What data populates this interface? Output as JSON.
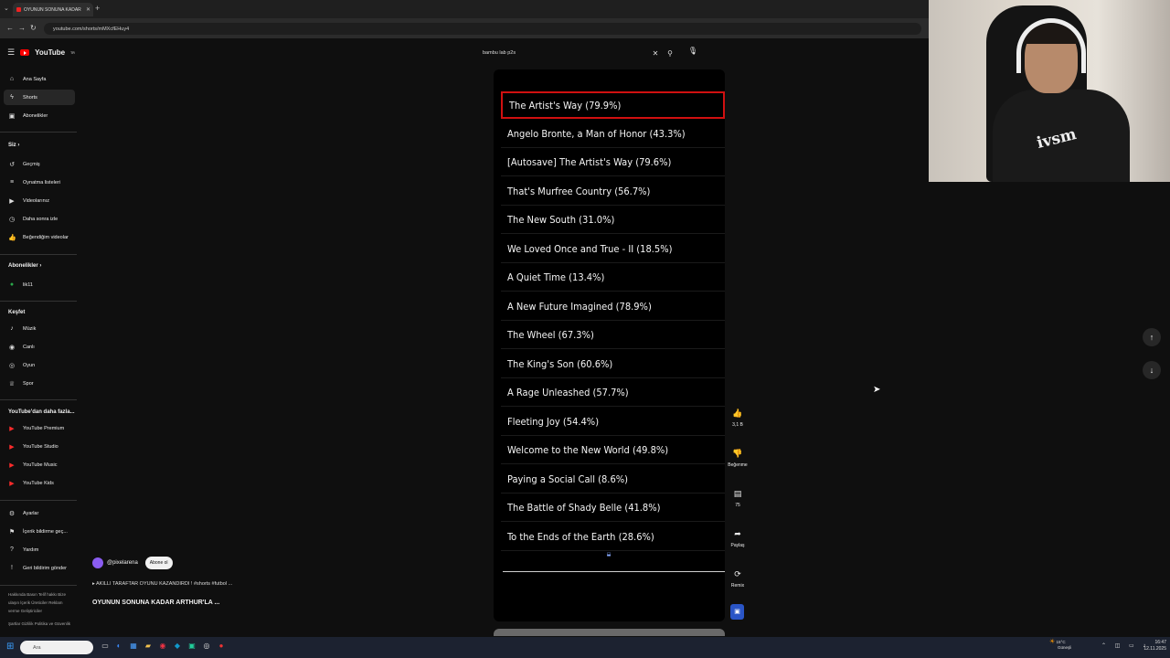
{
  "browser": {
    "tab_title": "OYUNUN SONUNA KADAR",
    "new_tab": "+",
    "url": "youtube.com/shorts/mMXcfEHuy4"
  },
  "youtube": {
    "logo": "YouTube",
    "logo_region": "TR",
    "search_value": "bambu lab p2s",
    "sidebar": {
      "main": [
        {
          "label": "Ana Sayfa",
          "icon": "home-icon"
        },
        {
          "label": "Shorts",
          "icon": "shorts-icon"
        },
        {
          "label": "Abonelikler",
          "icon": "subscriptions-icon"
        }
      ],
      "you_header": "Siz",
      "you": [
        {
          "label": "Geçmiş",
          "icon": "history-icon"
        },
        {
          "label": "Oynatma listeleri",
          "icon": "playlist-icon"
        },
        {
          "label": "Videolarınız",
          "icon": "video-icon"
        },
        {
          "label": "Daha sonra izle",
          "icon": "clock-icon"
        },
        {
          "label": "Beğendiğim videolar",
          "icon": "like-icon"
        }
      ],
      "subs_header": "Abonelikler",
      "subs": [
        {
          "label": "lik11",
          "icon": "channel-avatar-icon"
        }
      ],
      "explore_header": "Keşfet",
      "explore": [
        {
          "label": "Müzik",
          "icon": "music-icon"
        },
        {
          "label": "Canlı",
          "icon": "live-icon"
        },
        {
          "label": "Oyun",
          "icon": "gaming-icon"
        },
        {
          "label": "Spor",
          "icon": "trophy-icon"
        }
      ],
      "more_header": "YouTube'dan daha fazla...",
      "more": [
        {
          "label": "YouTube Premium",
          "icon": "yt-premium-icon"
        },
        {
          "label": "YouTube Studio",
          "icon": "yt-studio-icon"
        },
        {
          "label": "YouTube Music",
          "icon": "yt-music-icon"
        },
        {
          "label": "YouTube Kids",
          "icon": "yt-kids-icon"
        }
      ],
      "settings": [
        {
          "label": "Ayarlar",
          "icon": "gear-icon"
        },
        {
          "label": "İçerik bildirme geç...",
          "icon": "flag-icon"
        },
        {
          "label": "Yardım",
          "icon": "help-icon"
        },
        {
          "label": "Geri bildirim gönder",
          "icon": "feedback-icon"
        }
      ],
      "footer1": "Hakkında  Basın  Telif hakkı  Bize ulaşın  İçerik Üreticiler  Reklam verme  Geliştiriciler",
      "footer2": "Şartlar  Gizlilik  Politika ve Güvenlik"
    },
    "short": {
      "list": [
        "The Artist's Way (79.9%)",
        "Angelo Bronte, a Man of Honor (43.3%)",
        "[Autosave] The Artist's Way (79.6%)",
        "That's Murfree Country (56.7%)",
        "The New South (31.0%)",
        "We Loved Once and True - II (18.5%)",
        "A Quiet Time (13.4%)",
        "A New Future Imagined (78.9%)",
        "The Wheel (67.3%)",
        "The King's Son (60.6%)",
        "A Rage Unleashed (57.7%)",
        "Fleeting Joy (54.4%)",
        "Welcome to the New World (49.8%)",
        "Paying a Social Call (8.6%)",
        "The Battle of Shady Belle (41.8%)",
        "To the Ends of the Earth (28.6%)"
      ],
      "selected_index": 0,
      "channel": "@pixelarena",
      "subscribe": "Abone ol",
      "description": "AKILLI TARAFTAR  OYUNU KAZANDIRDI ! #shorts #futbol ...",
      "title": "OYUNUN SONUNA KADAR ARTHUR'LA ..."
    },
    "actions": {
      "like_count": "3,1 B",
      "dislike_label": "Beğenme",
      "comment_count": "75",
      "share_label": "Paylaş",
      "remix_label": "Remix"
    }
  },
  "webcam": {
    "shirt_text": "ivsm"
  },
  "taskbar": {
    "search_placeholder": "Ara",
    "weather_temp": "15°C",
    "weather_desc": "Güneşli",
    "time": "16:47",
    "date": "12.11.2025"
  }
}
